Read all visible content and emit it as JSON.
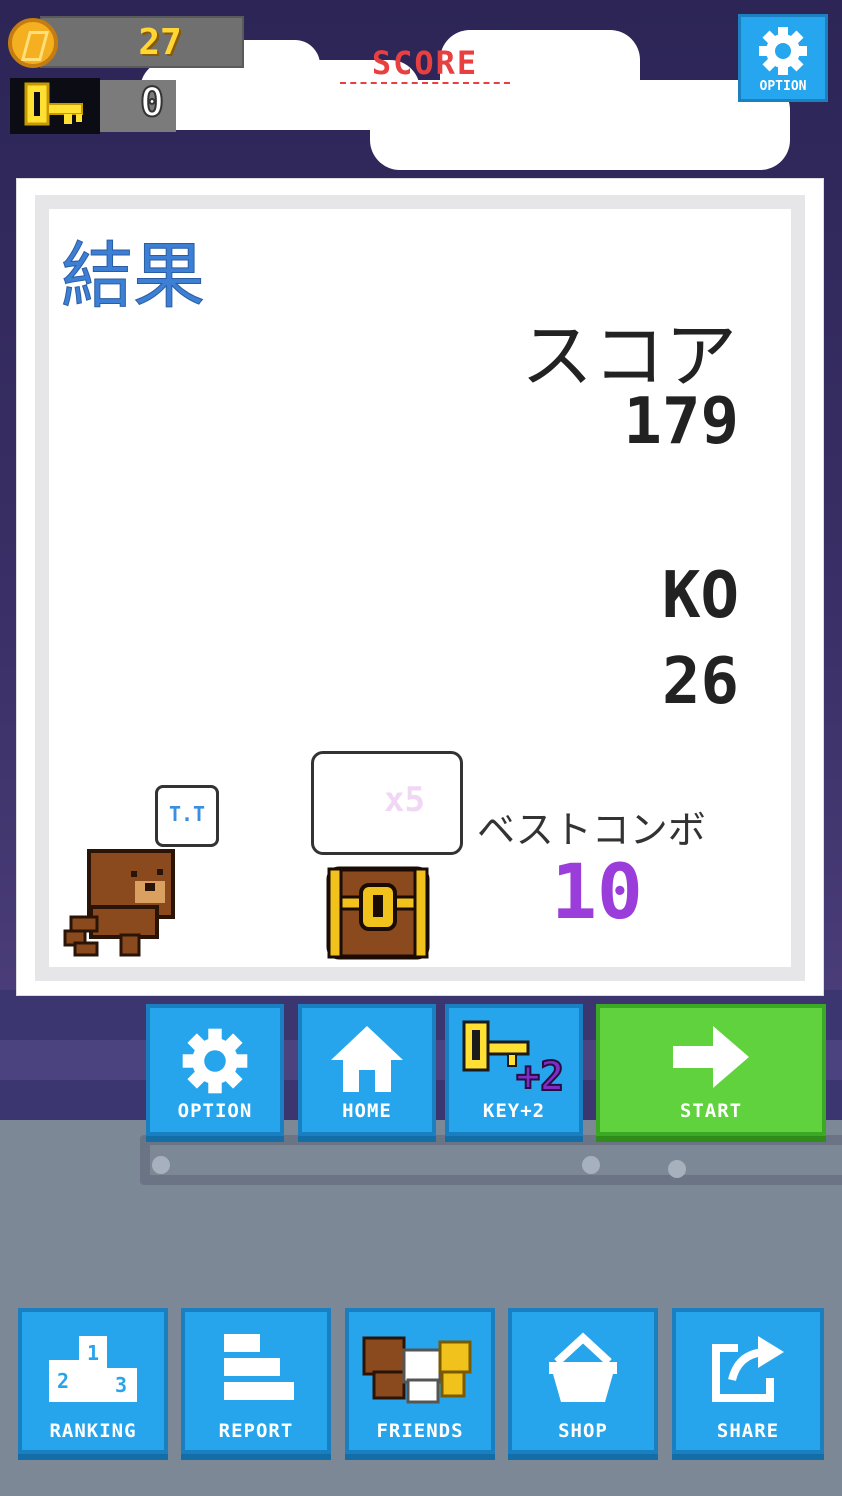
{
  "hud": {
    "coins": "27",
    "keys": "0",
    "score_label": "SCORE",
    "option_label": "OPTION"
  },
  "result": {
    "title": "結果",
    "score_label": "スコア",
    "score_value": "179",
    "ko_label": "KO",
    "ko_value": "26",
    "best_combo_label": "ベストコンボ",
    "best_combo_value": "10",
    "bear_bubble": "T.T",
    "chest_multiplier": "x5"
  },
  "actions": [
    {
      "label": "OPTION",
      "icon": "gear-icon"
    },
    {
      "label": "HOME",
      "icon": "home-icon"
    },
    {
      "label": "KEY+2",
      "icon": "key-plus-icon"
    },
    {
      "label": "START",
      "icon": "arrow-right-icon"
    }
  ],
  "menu": [
    {
      "label": "RANKING",
      "icon": "podium-icon"
    },
    {
      "label": "REPORT",
      "icon": "report-icon"
    },
    {
      "label": "FRIENDS",
      "icon": "friends-icon"
    },
    {
      "label": "SHOP",
      "icon": "basket-icon"
    },
    {
      "label": "SHARE",
      "icon": "share-icon"
    }
  ],
  "colors": {
    "button_blue": "#27a5ec",
    "button_green": "#5fd23d",
    "title_blue": "#3d7fd4",
    "combo_purple": "#9a3ddb",
    "score_red": "#e84040",
    "coin_yellow": "#ffd633"
  }
}
